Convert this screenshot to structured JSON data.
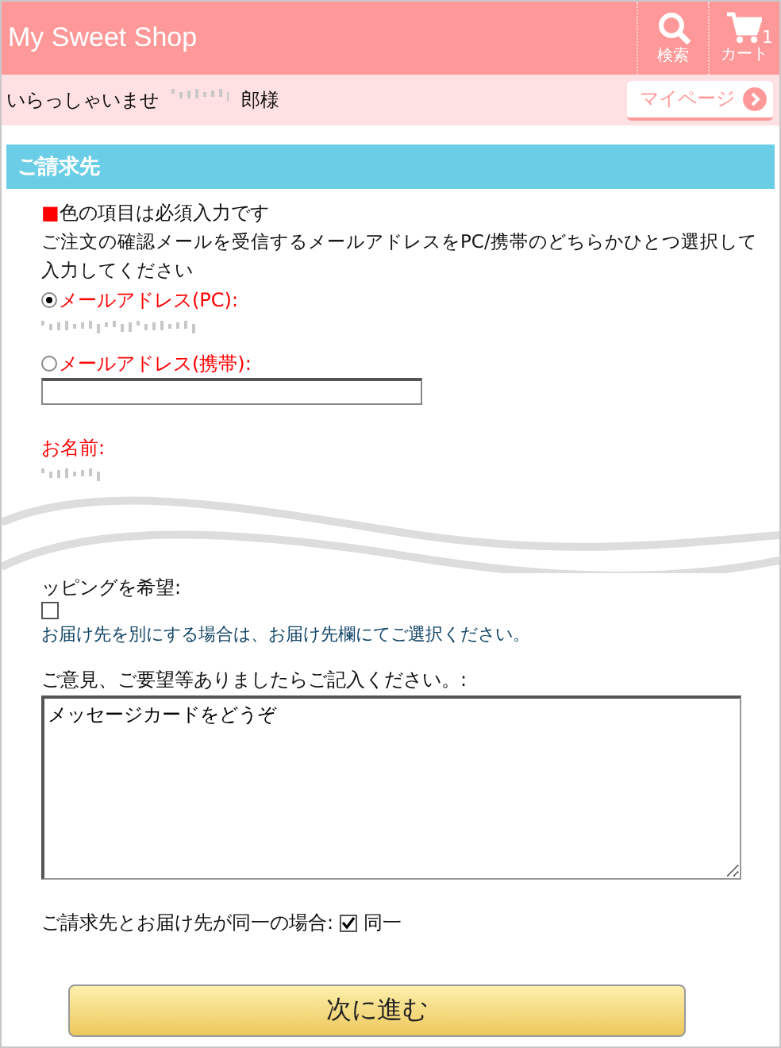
{
  "header": {
    "title": "My Sweet Shop",
    "search_label": "検索",
    "cart_label": "カート",
    "cart_count": "1"
  },
  "greeting": {
    "text": "いらっしゃいませ",
    "name_suffix": "郎様",
    "mypage_button": "マイページ"
  },
  "section_title": "ご請求先",
  "required_note": {
    "marker": "■",
    "text": "色の項目は必須入力です"
  },
  "instruction": "ご注文の確認メールを受信するメールアドレスをPC/携帯のどちらかひとつ選択して入力してください",
  "email_options": [
    {
      "label": "メールアドレス(PC):",
      "selected": true,
      "kind": "obscured"
    },
    {
      "label": "メールアドレス(携帯):",
      "selected": false,
      "kind": "input"
    }
  ],
  "name_label": "お名前:",
  "wrapping": {
    "label": "ッピングを希望:",
    "checked": false,
    "note": "お届け先を別にする場合は、お届け先欄にてご選択ください。"
  },
  "comment": {
    "label": "ご意見、ご要望等ありましたらご記入ください。:",
    "value": "メッセージカードをどうぞ"
  },
  "same_address": {
    "label": "ご請求先とお届け先が同一の場合:",
    "checked": true,
    "option": "同一"
  },
  "submit": "次に進む"
}
